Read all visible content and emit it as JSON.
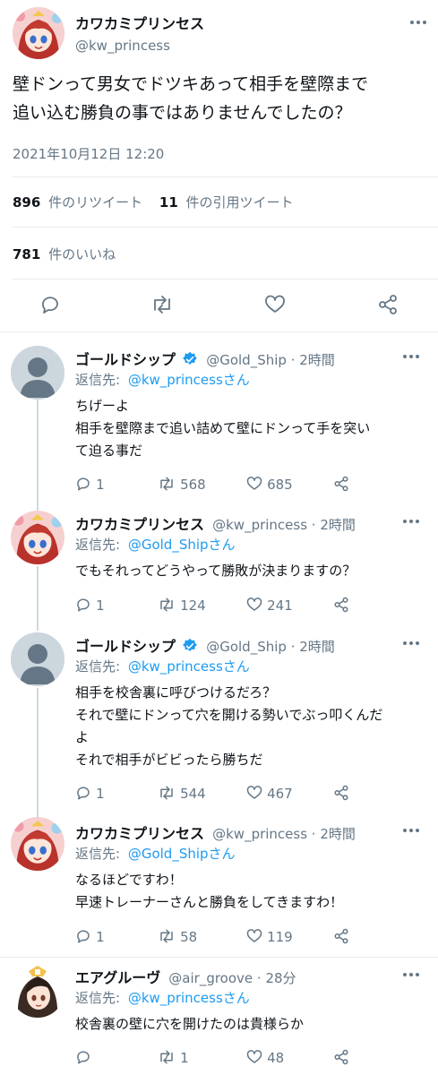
{
  "main": {
    "display_name": "カワカミプリンセス",
    "handle": "@kw_princess",
    "text_line1": "壁ドンって男女でドツキあって相手を壁際まで",
    "text_line2": "追い込む勝負の事ではありませんでしたの？",
    "timestamp": "2021年10月12日 12:20",
    "retweets_count": "896",
    "retweets_label": "件のリツイート",
    "quotes_count": "11",
    "quotes_label": "件の引用ツイート",
    "likes_count": "781",
    "likes_label": "件のいいね"
  },
  "colors": {
    "accent": "#1d9bf0",
    "muted": "#657786",
    "divider": "#e6ecf0"
  },
  "replies": [
    {
      "name": "ゴールドシップ",
      "verified": true,
      "handle": "@Gold_Ship · 2時間",
      "reply_prefix": "返信先:",
      "reply_to": "@kw_princessさん",
      "lines": [
        "ちげーよ",
        "相手を壁際まで追い詰めて壁にドンって手を突い",
        "て迫る事だ"
      ],
      "replies": "1",
      "retweets": "568",
      "likes": "685",
      "avatar": "default"
    },
    {
      "name": "カワカミプリンセス",
      "verified": false,
      "handle": "@kw_princess · 2時間",
      "reply_prefix": "返信先:",
      "reply_to": "@Gold_Shipさん",
      "lines": [
        "でもそれってどうやって勝敗が決まりますの？"
      ],
      "replies": "1",
      "retweets": "124",
      "likes": "241",
      "avatar": "princess"
    },
    {
      "name": "ゴールドシップ",
      "verified": true,
      "handle": "@Gold_Ship · 2時間",
      "reply_prefix": "返信先:",
      "reply_to": "@kw_princessさん",
      "lines": [
        "相手を校舎裏に呼びつけるだろ？",
        "それで壁にドンって穴を開ける勢いでぶっ叩くんだ",
        "よ",
        "それで相手がビビったら勝ちだ"
      ],
      "replies": "1",
      "retweets": "544",
      "likes": "467",
      "avatar": "default"
    },
    {
      "name": "カワカミプリンセス",
      "verified": false,
      "handle": "@kw_princess · 2時間",
      "reply_prefix": "返信先:",
      "reply_to": "@Gold_Shipさん",
      "lines": [
        "なるほどですわ！",
        "早速トレーナーさんと勝負をしてきますわ！"
      ],
      "replies": "1",
      "retweets": "58",
      "likes": "119",
      "avatar": "princess"
    },
    {
      "name": "エアグルーヴ",
      "verified": false,
      "handle": "@air_groove · 28分",
      "reply_prefix": "返信先:",
      "reply_to": "@kw_princessさん",
      "lines": [
        "校舎裏の壁に穴を開けたのは貴様らか"
      ],
      "replies": "",
      "retweets": "1",
      "likes": "48",
      "avatar": "groove"
    }
  ]
}
